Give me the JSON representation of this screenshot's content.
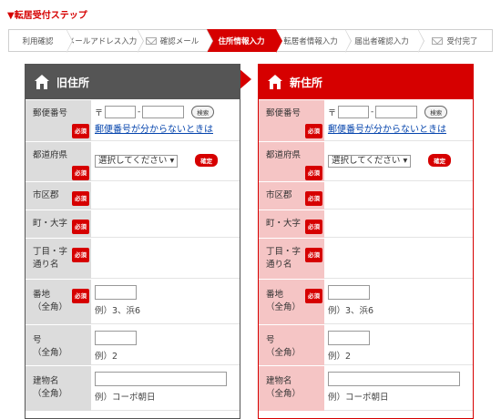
{
  "page_title": "▼転居受付ステップ",
  "steps": [
    {
      "label": "利用確認",
      "icon": ""
    },
    {
      "label": "メールアドレス入力",
      "icon": ""
    },
    {
      "label": "確認メール",
      "icon": "mail-icon"
    },
    {
      "label": "住所情報入力",
      "icon": "",
      "active": true
    },
    {
      "label": "転居者情報入力",
      "icon": ""
    },
    {
      "label": "届出者確認入力",
      "icon": ""
    },
    {
      "label": "受付完了",
      "icon": "mail-icon"
    }
  ],
  "required_label": "必須",
  "zip_symbol": "〒",
  "zip_dash": "-",
  "search_button": "検索",
  "zip_link": "郵便番号が分からないときは",
  "confirm_button": "確定",
  "old": {
    "title": "旧住所",
    "pref_select": "選択してください ▾"
  },
  "new": {
    "title": "新住所",
    "pref_select": "選択してください ▾"
  },
  "labels": {
    "zip": "郵便番号",
    "pref": "都道府県",
    "city": "市区郡",
    "town": "町・大字",
    "chome_1": "丁目・字",
    "chome_2": "通り名",
    "banchi_1": "番地",
    "banchi_2": "（全角）",
    "go_1": "号",
    "go_2": "（全角）",
    "bldg_1": "建物名",
    "bldg_2": "（全角）"
  },
  "examples": {
    "banchi": "例）3、浜6",
    "go": "例）2",
    "bldg": "例）コーポ朝日"
  },
  "colors": {
    "accent": "#d60000",
    "old_head": "#555555",
    "old_label_bg": "#dcdcdc",
    "new_label_bg": "#f5c5c5"
  }
}
